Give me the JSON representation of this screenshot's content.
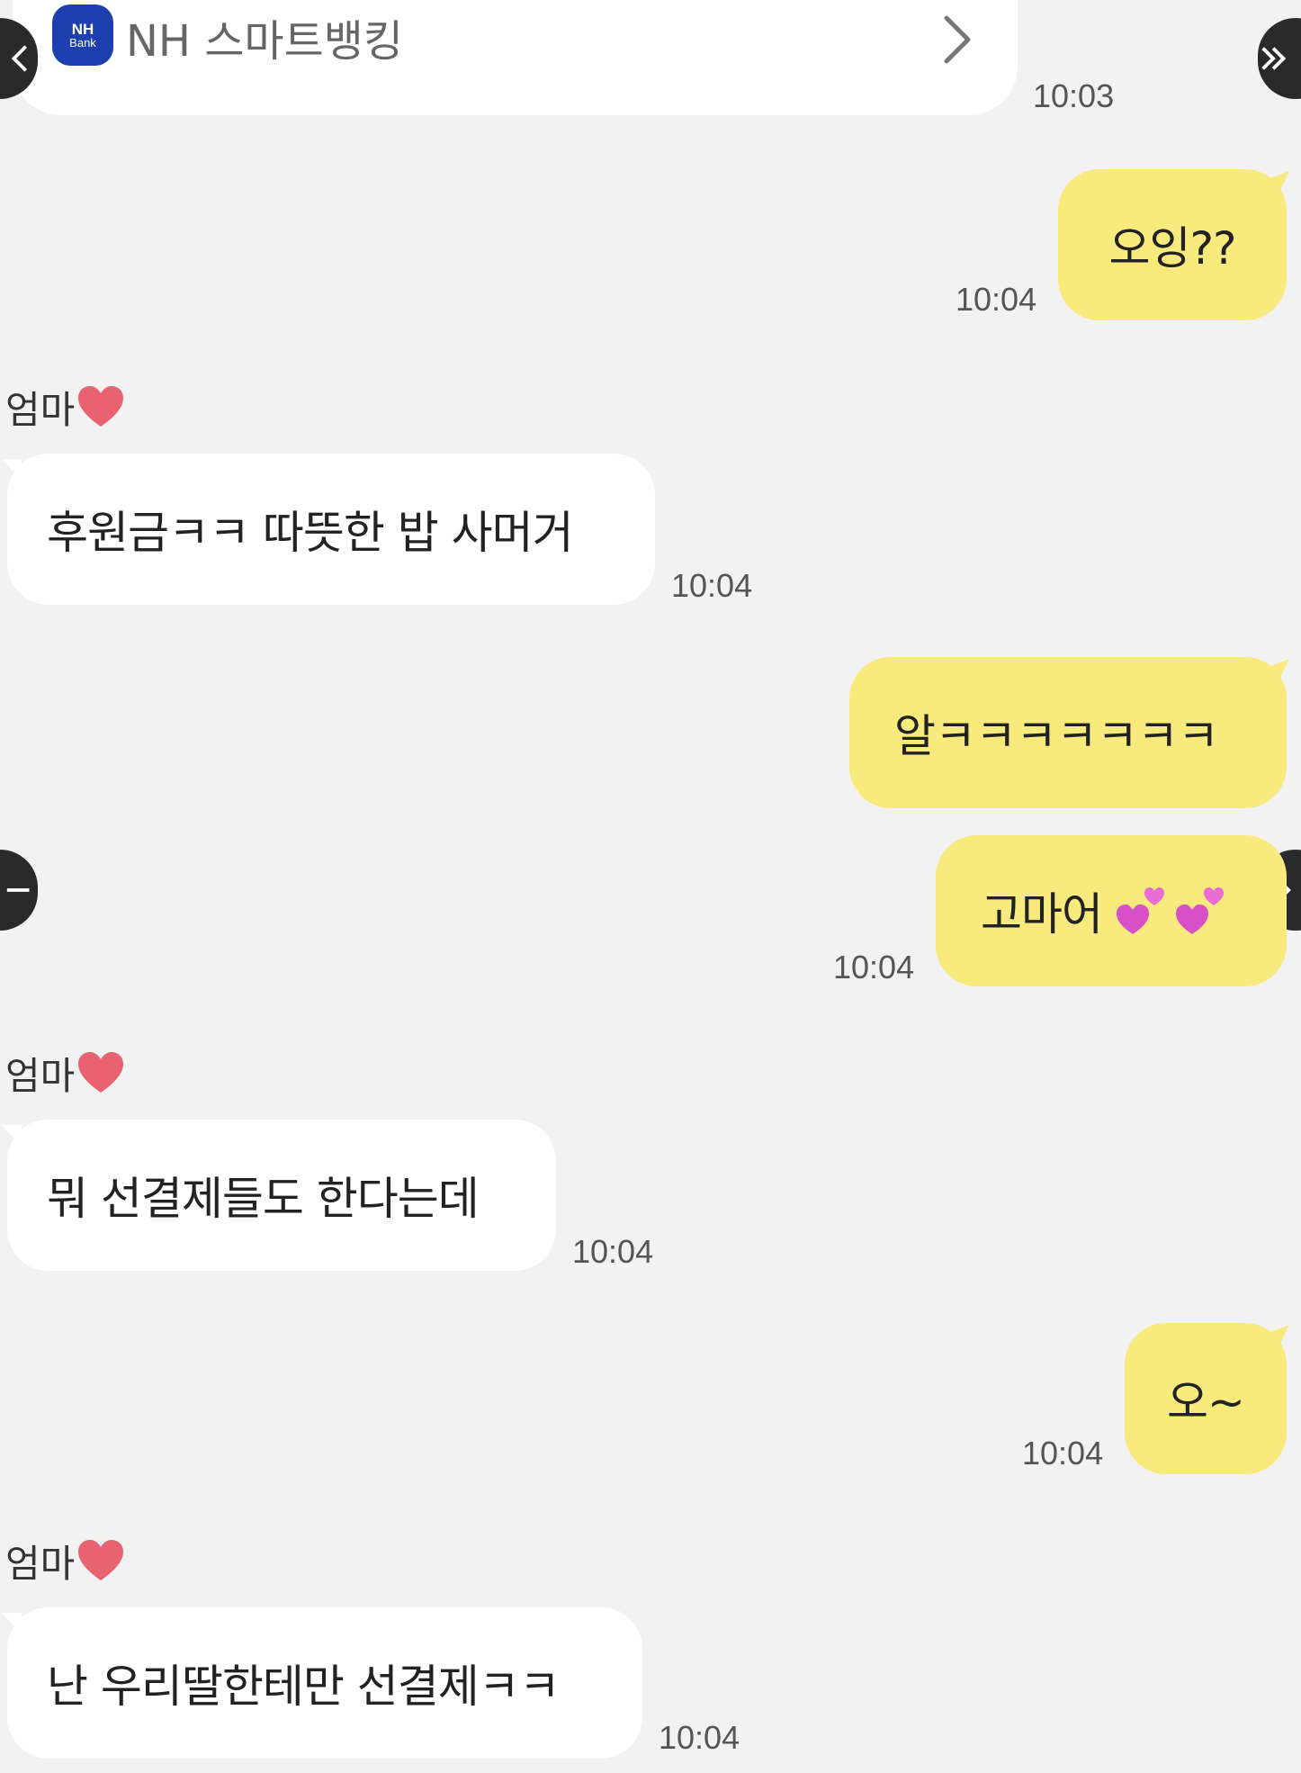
{
  "share_card": {
    "app_name": "NH 스마트뱅킹",
    "logo_text_top": "NH",
    "logo_text_bottom": "Bank",
    "time": "10:03"
  },
  "sender_name": "엄마",
  "messages": [
    {
      "side": "out",
      "text": "오잉??",
      "time": "10:04"
    },
    {
      "side": "in",
      "text": "후원금ㅋㅋ 따뜻한 밥 사머거",
      "time": "10:04"
    },
    {
      "side": "out",
      "text": "알ㅋㅋㅋㅋㅋㅋㅋ",
      "time": ""
    },
    {
      "side": "out",
      "text": "고마어",
      "time": "10:04"
    },
    {
      "side": "in",
      "text": "뭐 선결제들도 한다는데",
      "time": "10:04"
    },
    {
      "side": "out",
      "text": "오~",
      "time": "10:04"
    },
    {
      "side": "in",
      "text": "난 우리딸한테만 선결제ㅋㅋ",
      "time": "10:04"
    }
  ],
  "icons": {
    "chevron": "chevron-right-icon",
    "heart": "red-heart-emoji",
    "two_hearts": "two-hearts-emoji"
  },
  "colors": {
    "background": "#f2f2f2",
    "incoming_bubble": "#ffffff",
    "outgoing_bubble": "#f8ea7d"
  }
}
